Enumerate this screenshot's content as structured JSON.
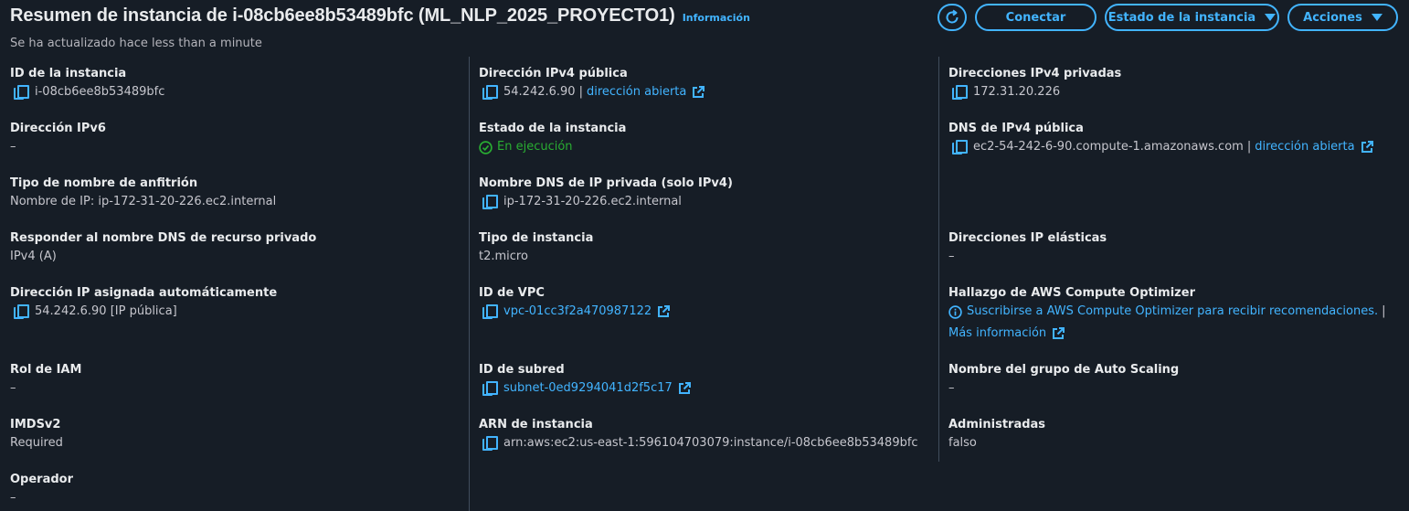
{
  "header": {
    "title": "Resumen de instancia de i-08cb6ee8b53489bfc (ML_NLP_2025_PROYECTO1)",
    "info_link": "Información",
    "subtitle": "Se ha actualizado hace less than a minute"
  },
  "actions": {
    "connect": "Conectar",
    "instance_state": "Estado de la instancia",
    "actions": "Acciones"
  },
  "col1": {
    "instance_id_label": "ID de la instancia",
    "instance_id": "i-08cb6ee8b53489bfc",
    "ipv6_label": "Dirección IPv6",
    "ipv6": "–",
    "hostname_type_label": "Tipo de nombre de anfitrión",
    "hostname_type": "Nombre de IP: ip-172-31-20-226.ec2.internal",
    "answer_dns_label": "Responder al nombre DNS de recurso privado",
    "answer_dns": "IPv4 (A)",
    "auto_ip_label": "Dirección IP asignada automáticamente",
    "auto_ip": "54.242.6.90 [IP pública]",
    "iam_role_label": "Rol de IAM",
    "iam_role": "–",
    "imdsv2_label": "IMDSv2",
    "imdsv2": "Required",
    "operator_label": "Operador",
    "operator": "–"
  },
  "col2": {
    "public_ipv4_label": "Dirección IPv4 pública",
    "public_ipv4": "54.242.6.90",
    "open_address": "dirección abierta",
    "state_label": "Estado de la instancia",
    "state": "En ejecución",
    "private_dns_label": "Nombre DNS de IP privada (solo IPv4)",
    "private_dns": "ip-172-31-20-226.ec2.internal",
    "instance_type_label": "Tipo de instancia",
    "instance_type": "t2.micro",
    "vpc_label": "ID de VPC",
    "vpc": "vpc-01cc3f2a470987122",
    "subnet_label": "ID de subred",
    "subnet": "subnet-0ed9294041d2f5c17",
    "arn_label": "ARN de instancia",
    "arn": "arn:aws:ec2:us-east-1:596104703079:instance/i-08cb6ee8b53489bfc"
  },
  "col3": {
    "private_ipv4_label": "Direcciones IPv4 privadas",
    "private_ipv4": "172.31.20.226",
    "public_dns_label": "DNS de IPv4 pública",
    "public_dns": "ec2-54-242-6-90.compute-1.amazonaws.com",
    "open_address": "dirección abierta",
    "elastic_ip_label": "Direcciones IP elásticas",
    "elastic_ip": "–",
    "optimizer_label": "Hallazgo de AWS Compute Optimizer",
    "optimizer_link": "Suscribirse a AWS Compute Optimizer para recibir recomendaciones.",
    "more_info": "Más información",
    "asg_label": "Nombre del grupo de Auto Scaling",
    "asg": "–",
    "managed_label": "Administradas",
    "managed": "falso"
  },
  "colors": {
    "background": "#161d26",
    "link": "#42b4ff",
    "success": "#29ad32",
    "label": "#e9ebed",
    "text": "#c6c6cd"
  }
}
